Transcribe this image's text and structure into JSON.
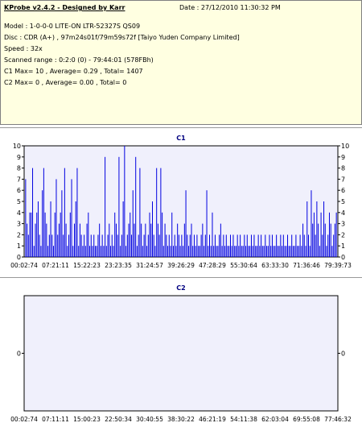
{
  "info": {
    "title": "KProbe v2.4.2 - Designed by Karr",
    "date": "Date : 27/12/2010 11:30:32 PM",
    "model": "Model : 1-0-0-0 LITE-ON LTR-52327S      QS09",
    "disc": "Disc : CDR (A+) , 97m24s01f/79m59s72f [Taiyo Yuden Company Limited]",
    "speed": "Speed : 32x",
    "range": "Scanned range : 0:2:0 (0) - 79:44:01 (578FBh)",
    "c1": "C1 Max= 10 , Average= 0.29 , Total= 1407",
    "c2": "C2 Max= 0 , Average= 0.00 , Total= 0"
  },
  "chart_data": [
    {
      "type": "bar",
      "title": "C1",
      "ylim": [
        0,
        10
      ],
      "yticks": [
        "10",
        "9",
        "8",
        "7",
        "6",
        "5",
        "4",
        "3",
        "2",
        "1",
        "0"
      ],
      "xticks": [
        "00:02:74",
        "07:21:11",
        "15:22:23",
        "23:23:35",
        "31:24:57",
        "39:26:29",
        "47:28:29",
        "55:30:64",
        "63:33:30",
        "71:36:46",
        "79:39:73"
      ],
      "values": [
        7,
        3,
        2,
        4,
        4,
        8,
        1,
        3,
        4,
        5,
        2,
        1,
        6,
        8,
        4,
        3,
        1,
        2,
        5,
        2,
        1,
        4,
        7,
        2,
        3,
        4,
        6,
        2,
        8,
        3,
        1,
        2,
        4,
        7,
        1,
        3,
        5,
        8,
        1,
        3,
        2,
        1,
        2,
        1,
        3,
        4,
        1,
        2,
        1,
        2,
        1,
        1,
        2,
        3,
        1,
        2,
        1,
        9,
        1,
        2,
        3,
        1,
        2,
        1,
        4,
        3,
        2,
        9,
        1,
        2,
        5,
        10,
        1,
        2,
        3,
        4,
        2,
        6,
        3,
        9,
        1,
        2,
        8,
        3,
        1,
        2,
        3,
        1,
        2,
        4,
        3,
        5,
        2,
        1,
        8,
        3,
        2,
        8,
        4,
        1,
        3,
        2,
        1,
        2,
        1,
        4,
        1,
        2,
        1,
        3,
        2,
        1,
        2,
        1,
        3,
        6,
        2,
        1,
        2,
        3,
        1,
        2,
        1,
        2,
        1,
        1,
        2,
        3,
        1,
        2,
        6,
        1,
        2,
        1,
        4,
        1,
        2,
        1,
        1,
        2,
        3,
        1,
        2,
        1,
        2,
        1,
        1,
        2,
        1,
        2,
        1,
        1,
        2,
        1,
        2,
        1,
        1,
        2,
        1,
        2,
        1,
        1,
        2,
        1,
        2,
        1,
        1,
        2,
        1,
        2,
        1,
        1,
        2,
        1,
        1,
        2,
        1,
        2,
        1,
        1,
        2,
        1,
        1,
        2,
        1,
        2,
        1,
        1,
        2,
        1,
        1,
        2,
        1,
        1,
        2,
        1,
        1,
        2,
        1,
        3,
        2,
        1,
        5,
        2,
        1,
        6,
        3,
        4,
        2,
        5,
        3,
        1,
        4,
        2,
        5,
        3,
        1,
        2,
        4,
        3,
        1,
        2,
        3,
        4
      ]
    },
    {
      "type": "bar",
      "title": "C2",
      "ylim": [
        0,
        0
      ],
      "yticks": [
        "0"
      ],
      "xticks": [
        "00:02:74",
        "07:11:11",
        "15:00:23",
        "22:50:34",
        "30:40:55",
        "38:30:22",
        "46:21:19",
        "54:11:38",
        "62:03:04",
        "69:55:08",
        "77:46:32"
      ],
      "values": []
    }
  ]
}
